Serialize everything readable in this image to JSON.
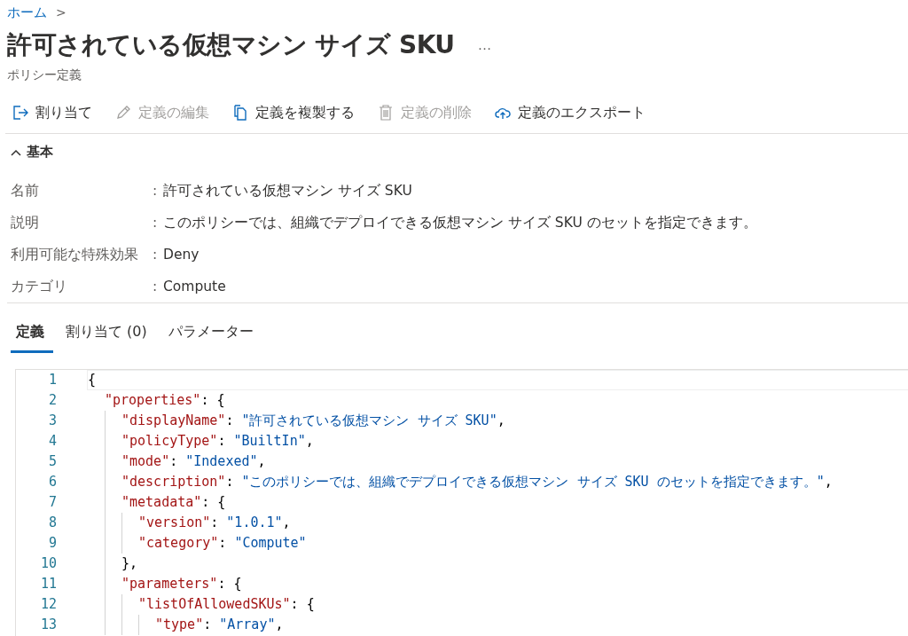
{
  "breadcrumb": [
    {
      "label": "ホーム",
      "separator": ">"
    }
  ],
  "title": "許可されている仮想マシン サイズ SKU",
  "more": "…",
  "subtitle": "ポリシー定義",
  "toolbar": [
    {
      "label": "割り当て",
      "kind": "assign",
      "disabled": false
    },
    {
      "label": "定義の編集",
      "kind": "edit",
      "disabled": true
    },
    {
      "label": "定義を複製する",
      "kind": "copy",
      "disabled": false
    },
    {
      "label": "定義の削除",
      "kind": "delete",
      "disabled": true
    },
    {
      "label": "定義のエクスポート",
      "kind": "export",
      "disabled": false
    }
  ],
  "essentials": {
    "title": "基本",
    "expanded": true,
    "rows": [
      {
        "label": "名前",
        "separator": ":",
        "value": "許可されている仮想マシン サイズ SKU"
      },
      {
        "label": "説明",
        "separator": ":",
        "value": "このポリシーでは、組織でデプロイできる仮想マシン サイズ SKU のセットを指定できます。"
      },
      {
        "label": "利用可能な特殊効果",
        "separator": ":",
        "value": "Deny"
      },
      {
        "label": "カテゴリ",
        "separator": ":",
        "value": "Compute"
      }
    ]
  },
  "tabs": [
    {
      "label": "定義",
      "selected": true
    },
    {
      "label": "割り当て (0)",
      "selected": false
    },
    {
      "label": "パラメーター",
      "selected": false
    }
  ],
  "code": [
    {
      "number": "1",
      "current": true,
      "tokens": [
        {
          "kind": "punct",
          "text": "{"
        }
      ],
      "children": [
        {
          "number": "2",
          "current": false,
          "tokens": [
            {
              "kind": "key",
              "text": "\"properties\""
            },
            {
              "kind": "punct",
              "text": ": {"
            }
          ],
          "children": [
            {
              "number": "3",
              "current": false,
              "tokens": [
                {
                  "kind": "key",
                  "text": "\"displayName\""
                },
                {
                  "kind": "punct",
                  "text": ": "
                },
                {
                  "kind": "string",
                  "text": "\"許可されている仮想マシン サイズ SKU\""
                },
                {
                  "kind": "punct",
                  "text": ","
                }
              ]
            },
            {
              "number": "4",
              "current": false,
              "tokens": [
                {
                  "kind": "key",
                  "text": "\"policyType\""
                },
                {
                  "kind": "punct",
                  "text": ": "
                },
                {
                  "kind": "string",
                  "text": "\"BuiltIn\""
                },
                {
                  "kind": "punct",
                  "text": ","
                }
              ]
            },
            {
              "number": "5",
              "current": false,
              "tokens": [
                {
                  "kind": "key",
                  "text": "\"mode\""
                },
                {
                  "kind": "punct",
                  "text": ": "
                },
                {
                  "kind": "string",
                  "text": "\"Indexed\""
                },
                {
                  "kind": "punct",
                  "text": ","
                }
              ]
            },
            {
              "number": "6",
              "current": false,
              "tokens": [
                {
                  "kind": "key",
                  "text": "\"description\""
                },
                {
                  "kind": "punct",
                  "text": ": "
                },
                {
                  "kind": "string",
                  "text": "\"このポリシーでは、組織でデプロイできる仮想マシン サイズ SKU のセットを指定できます。\""
                },
                {
                  "kind": "punct",
                  "text": ","
                }
              ]
            },
            {
              "number": "7",
              "current": false,
              "tokens": [
                {
                  "kind": "key",
                  "text": "\"metadata\""
                },
                {
                  "kind": "punct",
                  "text": ": {"
                }
              ],
              "children": [
                {
                  "number": "8",
                  "current": false,
                  "tokens": [
                    {
                      "kind": "key",
                      "text": "\"version\""
                    },
                    {
                      "kind": "punct",
                      "text": ": "
                    },
                    {
                      "kind": "string",
                      "text": "\"1.0.1\""
                    },
                    {
                      "kind": "punct",
                      "text": ","
                    }
                  ]
                },
                {
                  "number": "9",
                  "current": false,
                  "tokens": [
                    {
                      "kind": "key",
                      "text": "\"category\""
                    },
                    {
                      "kind": "punct",
                      "text": ": "
                    },
                    {
                      "kind": "string",
                      "text": "\"Compute\""
                    }
                  ]
                }
              ]
            },
            {
              "number": "10",
              "current": false,
              "tokens": [
                {
                  "kind": "punct",
                  "text": "},"
                }
              ]
            },
            {
              "number": "11",
              "current": false,
              "tokens": [
                {
                  "kind": "key",
                  "text": "\"parameters\""
                },
                {
                  "kind": "punct",
                  "text": ": {"
                }
              ],
              "children": [
                {
                  "number": "12",
                  "current": false,
                  "tokens": [
                    {
                      "kind": "key",
                      "text": "\"listOfAllowedSKUs\""
                    },
                    {
                      "kind": "punct",
                      "text": ": {"
                    }
                  ],
                  "children": [
                    {
                      "number": "13",
                      "current": false,
                      "tokens": [
                        {
                          "kind": "key",
                          "text": "\"type\""
                        },
                        {
                          "kind": "punct",
                          "text": ": "
                        },
                        {
                          "kind": "string",
                          "text": "\"Array\""
                        },
                        {
                          "kind": "punct",
                          "text": ","
                        }
                      ]
                    }
                  ]
                }
              ]
            }
          ]
        }
      ]
    }
  ]
}
